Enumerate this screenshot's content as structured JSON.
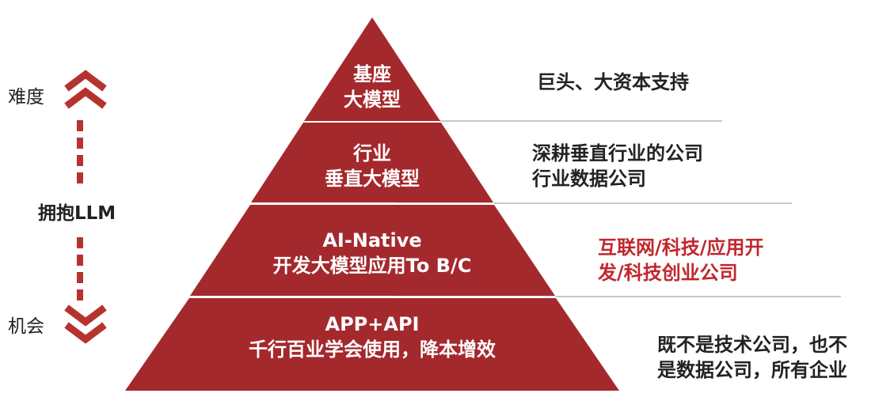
{
  "colors": {
    "pyramid_fill": "#a4292d",
    "accent_text": "#c0272d",
    "divider_line": "#c8c8c8",
    "arrow_color": "#b5332f"
  },
  "side": {
    "top_label": "难度",
    "middle_label": "拥抱LLM",
    "bottom_label": "机会",
    "top_icon": "double-chevron-up-icon",
    "bottom_icon": "double-chevron-down-icon"
  },
  "layers": [
    {
      "line1": "基座",
      "line2": "大模型"
    },
    {
      "line1": "行业",
      "line2": "垂直大模型"
    },
    {
      "line1": "AI-Native",
      "line2": "开发大模型应用To B/C"
    },
    {
      "line1": "APP+API",
      "line2": "千行百业学会使用，降本增效"
    }
  ],
  "descriptions": [
    {
      "line1": "巨头、大资本支持"
    },
    {
      "line1": "深耕垂直行业的公司",
      "line2": "行业数据公司"
    },
    {
      "line1": "互联网/科技/应用开",
      "line2": "发/科技创业公司"
    },
    {
      "line1": "既不是技术公司，也不",
      "line2": "是数据公司，所有企业"
    }
  ]
}
